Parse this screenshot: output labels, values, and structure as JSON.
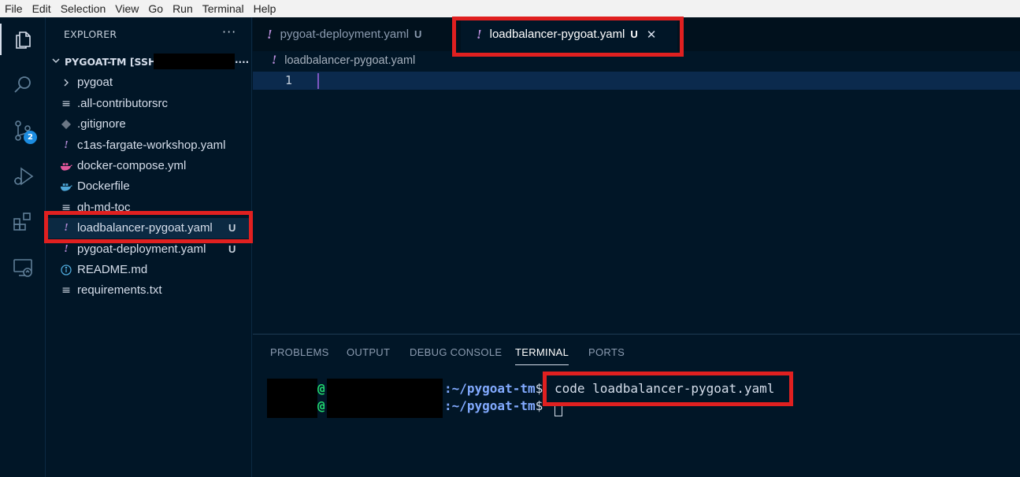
{
  "menubar": {
    "items": [
      "File",
      "Edit",
      "Selection",
      "View",
      "Go",
      "Run",
      "Terminal",
      "Help"
    ]
  },
  "activity_bar": {
    "icons": [
      "explorer-icon",
      "search-icon",
      "source-control-icon",
      "run-debug-icon",
      "extensions-icon",
      "remote-explorer-icon"
    ],
    "source_control_badge": "2"
  },
  "explorer": {
    "title": "EXPLORER",
    "more": "···",
    "root_label": "PYGOAT-TM [SSH:",
    "root_suffix": "....",
    "items": [
      {
        "label": "pygoat",
        "icon": "chevron-right-icon",
        "status": ""
      },
      {
        "label": ".all-contributorsrc",
        "icon": "lines-file-icon",
        "status": ""
      },
      {
        "label": ".gitignore",
        "icon": "git-diamond-icon",
        "status": ""
      },
      {
        "label": "c1as-fargate-workshop.yaml",
        "icon": "yaml-icon",
        "status": ""
      },
      {
        "label": "docker-compose.yml",
        "icon": "docker-icon",
        "status": ""
      },
      {
        "label": "Dockerfile",
        "icon": "docker-icon",
        "status": ""
      },
      {
        "label": "gh-md-toc",
        "icon": "lines-file-icon",
        "status": ""
      },
      {
        "label": "loadbalancer-pygoat.yaml",
        "icon": "yaml-icon",
        "status": "U"
      },
      {
        "label": "pygoat-deployment.yaml",
        "icon": "yaml-icon",
        "status": "U"
      },
      {
        "label": "README.md",
        "icon": "info-icon",
        "status": ""
      },
      {
        "label": "requirements.txt",
        "icon": "lines-file-icon",
        "status": ""
      }
    ]
  },
  "tabs": [
    {
      "label": "pygoat-deployment.yaml",
      "status": "U",
      "active": false
    },
    {
      "label": "loadbalancer-pygoat.yaml",
      "status": "U",
      "active": true,
      "close": "✕"
    }
  ],
  "editor": {
    "breadcrumb": "loadbalancer-pygoat.yaml",
    "line_number": "1"
  },
  "panel": {
    "tabs": [
      "PROBLEMS",
      "OUTPUT",
      "DEBUG CONSOLE",
      "TERMINAL",
      "PORTS"
    ],
    "active_tab": "TERMINAL",
    "terminal": {
      "at": "@",
      "path": ":~/pygoat-tm",
      "dollar": "$",
      "command": "code loadbalancer-pygoat.yaml"
    }
  },
  "colors": {
    "background": "#011627",
    "highlight_box": "#e02020",
    "yaml_icon": "#b48ad6",
    "terminal_user": "#22da6e",
    "terminal_path": "#82aaff"
  }
}
